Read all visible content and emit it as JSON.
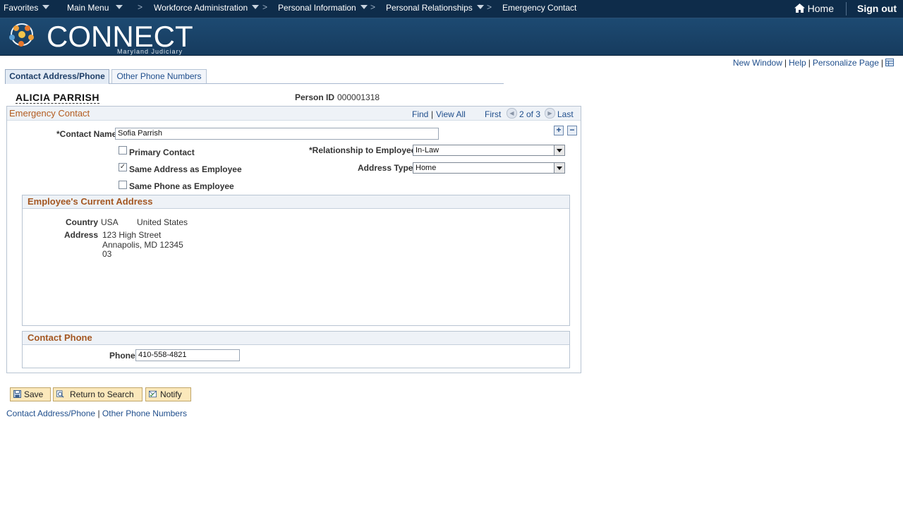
{
  "nav": {
    "favorites": "Favorites",
    "main_menu": "Main Menu",
    "breadcrumbs": [
      "Workforce Administration",
      "Personal Information",
      "Personal Relationships",
      "Emergency Contact"
    ],
    "home": "Home",
    "sign_out": "Sign out"
  },
  "brand": {
    "logo_text": "CONNECT",
    "logo_sub": "Maryland Judiciary"
  },
  "utility_links": {
    "new_window": "New Window",
    "help": "Help",
    "personalize": "Personalize Page"
  },
  "tabs": [
    {
      "label": "Contact Address/Phone",
      "active": true
    },
    {
      "label": "Other Phone Numbers",
      "active": false
    }
  ],
  "person": {
    "name": "ALICIA PARRISH",
    "id_label": "Person ID",
    "id_value": "000001318"
  },
  "emergency_contact": {
    "title": "Emergency Contact",
    "find": "Find",
    "view_all": "View All",
    "first": "First",
    "position": "2 of 3",
    "last": "Last",
    "contact_name_label": "*Contact Name",
    "contact_name_value": "Sofia Parrish",
    "primary_contact_label": "Primary Contact",
    "primary_contact_checked": false,
    "same_address_label": "Same Address as Employee",
    "same_address_checked": true,
    "same_phone_label": "Same Phone as Employee",
    "same_phone_checked": false,
    "relationship_label": "*Relationship to Employee",
    "relationship_value": "In-Law",
    "address_type_label": "Address Type",
    "address_type_value": "Home"
  },
  "current_address": {
    "title": "Employee's Current Address",
    "country_label": "Country",
    "country_code": "USA",
    "country_name": "United States",
    "address_label": "Address",
    "address_lines": [
      "123 High Street",
      "Annapolis, MD 12345",
      "03"
    ]
  },
  "contact_phone": {
    "title": "Contact Phone",
    "phone_label": "Phone",
    "phone_value": "410-558-4821"
  },
  "buttons": {
    "save": "Save",
    "return_to_search": "Return to Search",
    "notify": "Notify"
  },
  "bottom_links": {
    "contact_address": "Contact Address/Phone",
    "other_phone": "Other Phone Numbers",
    "separator": "|"
  }
}
